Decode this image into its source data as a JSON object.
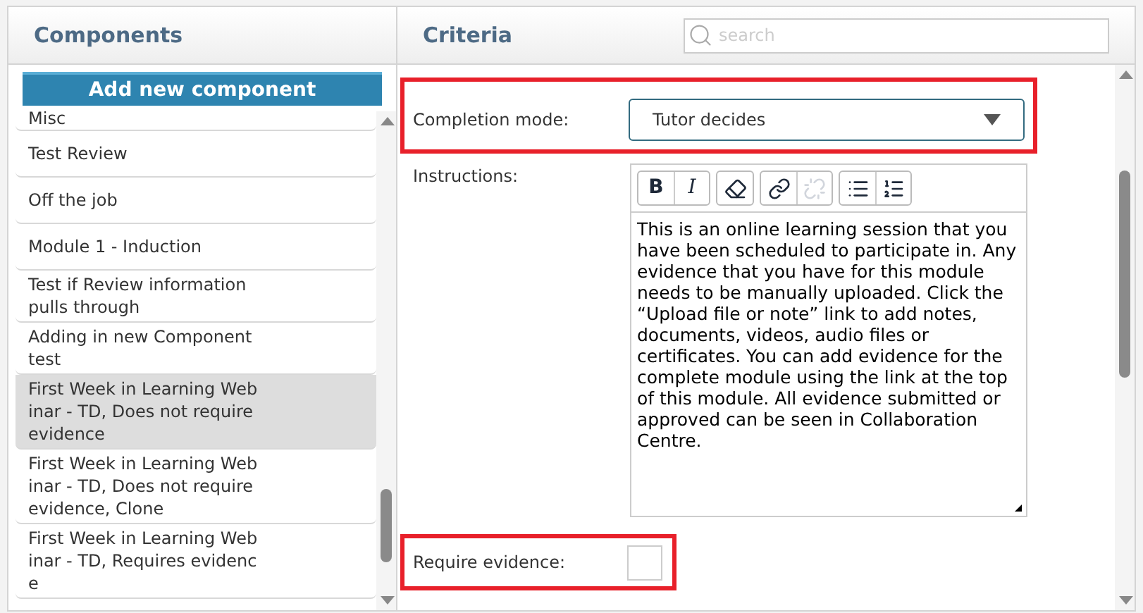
{
  "components_panel": {
    "title": "Components",
    "add_button": "Add new component",
    "items": [
      {
        "lines": [
          "Misc"
        ],
        "selected": false,
        "partial": true
      },
      {
        "lines": [
          "Test Review"
        ],
        "selected": false
      },
      {
        "lines": [
          "Off the job"
        ],
        "selected": false
      },
      {
        "lines": [
          "Module 1 - Induction"
        ],
        "selected": false
      },
      {
        "lines": [
          "Test if Review information",
          "pulls through"
        ],
        "selected": false
      },
      {
        "lines": [
          "Adding in new Component",
          "test"
        ],
        "selected": false
      },
      {
        "lines": [
          "First Week in Learning Web",
          "inar - TD, Does not require",
          "evidence"
        ],
        "selected": true
      },
      {
        "lines": [
          "First Week in Learning Web",
          "inar - TD, Does not require",
          "evidence, Clone"
        ],
        "selected": false
      },
      {
        "lines": [
          "First Week in Learning Web",
          "inar - TD, Requires evidenc",
          "e"
        ],
        "selected": false
      }
    ]
  },
  "criteria_panel": {
    "title": "Criteria",
    "search": {
      "placeholder": "search"
    },
    "completion_mode": {
      "label": "Completion mode:",
      "value": "Tutor decides",
      "highlighted": true
    },
    "instructions": {
      "label": "Instructions:",
      "toolbar": [
        [
          {
            "kind": "bold",
            "text": "B",
            "disabled": false
          },
          {
            "kind": "italic",
            "text": "I",
            "disabled": false
          }
        ],
        [
          {
            "kind": "remove-format",
            "disabled": false
          }
        ],
        [
          {
            "kind": "link",
            "disabled": false
          },
          {
            "kind": "unlink",
            "disabled": true
          }
        ],
        [
          {
            "kind": "bullets",
            "disabled": false
          },
          {
            "kind": "numbers",
            "disabled": false
          }
        ]
      ],
      "text": "This is an online learning session that you have been scheduled to participate in. Any evidence that you have for this module needs to be manually uploaded. Click the “Upload file or note” link to add notes, documents, videos, audio files or certificates. You can add evidence for the complete module using the link at the top of this module. All evidence submitted or approved can be seen in Collaboration Centre."
    },
    "require_evidence": {
      "label": "Require evidence:",
      "checked": false,
      "highlighted": true
    }
  }
}
